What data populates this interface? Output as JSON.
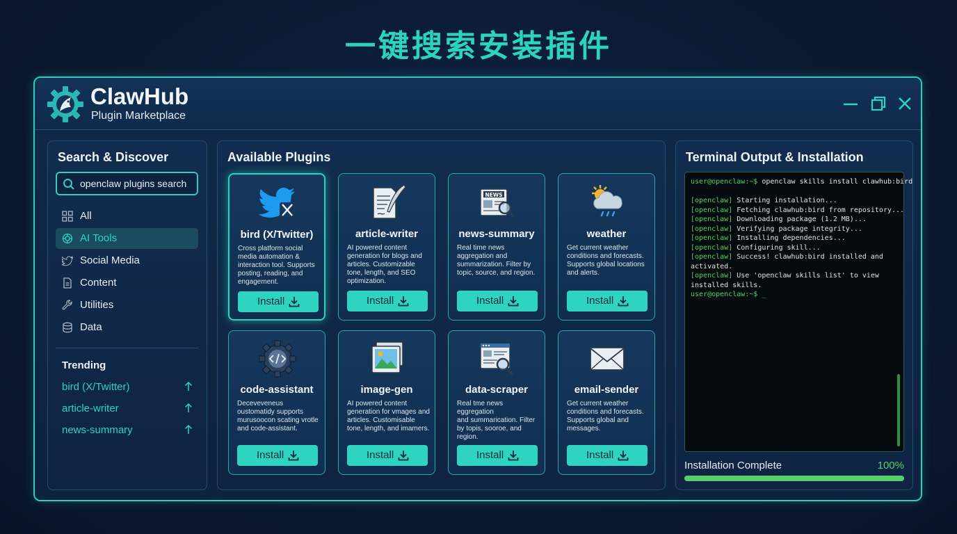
{
  "headline": "一键搜索安装插件",
  "app": {
    "name": "ClawHub",
    "subtitle": "Plugin Marketplace",
    "logo_icon": "claw-gear-logo",
    "window_controls": [
      "minimize-icon",
      "maximize-icon",
      "close-icon"
    ]
  },
  "sidebar": {
    "title": "Search & Discover",
    "search": {
      "value": "openclaw plugins search",
      "icon": "search-icon"
    },
    "nav": [
      {
        "label": "All",
        "icon": "grid-icon",
        "active": false
      },
      {
        "label": "AI Tools",
        "icon": "ai-icon",
        "active": true
      },
      {
        "label": "Social Media",
        "icon": "bird-icon",
        "active": false
      },
      {
        "label": "Content",
        "icon": "document-icon",
        "active": false
      },
      {
        "label": "Utilities",
        "icon": "wrench-icon",
        "active": false
      },
      {
        "label": "Data",
        "icon": "database-icon",
        "active": false
      }
    ],
    "trending_title": "Trending",
    "trending": [
      {
        "label": "bird (X/Twitter)",
        "icon": "arrow-up-icon"
      },
      {
        "label": "article-writer",
        "icon": "arrow-up-icon"
      },
      {
        "label": "news-summary",
        "icon": "arrow-up-icon"
      }
    ]
  },
  "plugins": {
    "title": "Available Plugins",
    "install_label": "Install",
    "items": [
      {
        "name": "bird (X/Twitter)",
        "icon": "twitter-bird-icon",
        "featured": true,
        "desc": [
          "Cross platform social",
          "media automation &",
          "interaction tool. Supports",
          "posting, reading, and",
          "engagement."
        ]
      },
      {
        "name": "article-writer",
        "icon": "quill-document-icon",
        "featured": false,
        "desc": [
          "AI powered content",
          "generation for blogs and",
          "articles. Customizable",
          "tone, length, and SEO",
          "optimization."
        ]
      },
      {
        "name": "news-summary",
        "icon": "newspaper-icon",
        "featured": false,
        "desc": [
          "Real time news",
          "aggregation and",
          "summarization. Filter by",
          "topic, source, and region."
        ]
      },
      {
        "name": "weather",
        "icon": "weather-cloud-icon",
        "featured": false,
        "desc": [
          "Get current weather",
          "conditions and forecasts.",
          "Supports global locations",
          "and alerts."
        ]
      },
      {
        "name": "code-assistant",
        "icon": "code-gear-icon",
        "featured": false,
        "desc": [
          "Deceveveneus",
          "oustomatidy supports",
          "murusoocon scating vrotle",
          "and code-assistant."
        ]
      },
      {
        "name": "image-gen",
        "icon": "image-stack-icon",
        "featured": false,
        "desc": [
          "AI powered content",
          "generation for vmages and",
          "articles. Customisable",
          "tone, length, and imamers."
        ]
      },
      {
        "name": "data-scraper",
        "icon": "browser-magnifier-icon",
        "featured": false,
        "desc": [
          "Real tme news eggregation",
          "and summarication. Filter",
          "by topis, sooroe, and",
          "region."
        ]
      },
      {
        "name": "email-sender",
        "icon": "envelope-icon",
        "featured": false,
        "desc": [
          "Get current weather",
          "conditions and forecasts.",
          "Supports global and",
          "messages."
        ]
      }
    ]
  },
  "terminal": {
    "title": "Terminal Output & Installation",
    "prompt": "user@openclaw:~$",
    "command": " openclaw skills install clawhub:bird",
    "lines": [
      {
        "tag": "[openclaw]",
        "text": " Starting installation..."
      },
      {
        "tag": "[openclaw]",
        "text": " Fetching clawhub:bird from repository..."
      },
      {
        "tag": "[openclaw]",
        "text": " Downloading package (1.2 MB)..."
      },
      {
        "tag": "[openclaw]",
        "text": " Verifying package integrity..."
      },
      {
        "tag": "[openclaw]",
        "text": " Installing dependencies..."
      },
      {
        "tag": "[openclaw]",
        "text": " Configuring skill..."
      },
      {
        "tag": "[openclaw]",
        "text": " Success! clawhub:bird installed and"
      },
      {
        "tag": "",
        "text": "activated."
      },
      {
        "tag": "[openclaw]",
        "text": " Use 'openclaw skills list' to view"
      },
      {
        "tag": "",
        "text": "installed skills."
      }
    ],
    "cursor": "_",
    "status_label": "Installation Complete",
    "progress_text": "100%",
    "progress": 1.0
  }
}
